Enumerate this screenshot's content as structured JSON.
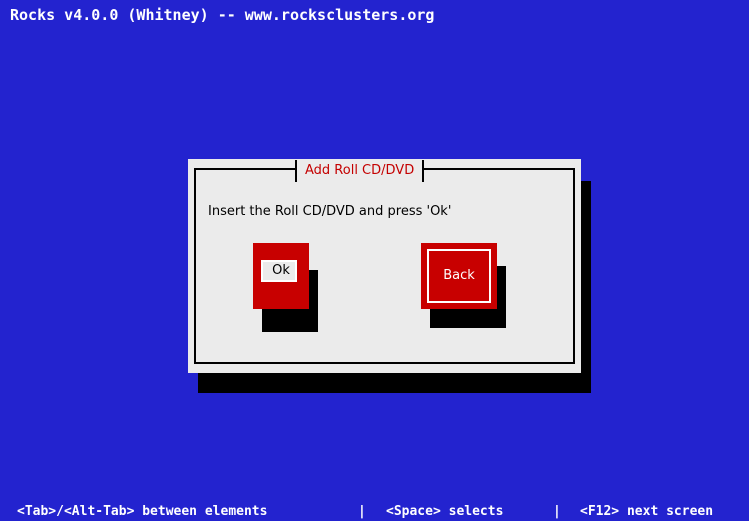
{
  "window": {
    "title": "Rocks v4.0.0 (Whitney) -- www.rocksclusters.org"
  },
  "dialog": {
    "title": "Add Roll CD/DVD",
    "message": "Insert the Roll CD/DVD and press 'Ok'",
    "buttons": {
      "ok_label": "Ok",
      "back_label": "Back"
    }
  },
  "statusbar": {
    "hint_tab": "<Tab>/<Alt-Tab> between elements",
    "separator": "|",
    "hint_space": "<Space> selects",
    "hint_f12": "<F12> next screen"
  },
  "colors": {
    "background": "#2323cf",
    "dialog": "#ebebeb",
    "accent": "#c80000",
    "title_text": "#c40000",
    "shadow": "#000000",
    "text_light": "#ffffff"
  }
}
